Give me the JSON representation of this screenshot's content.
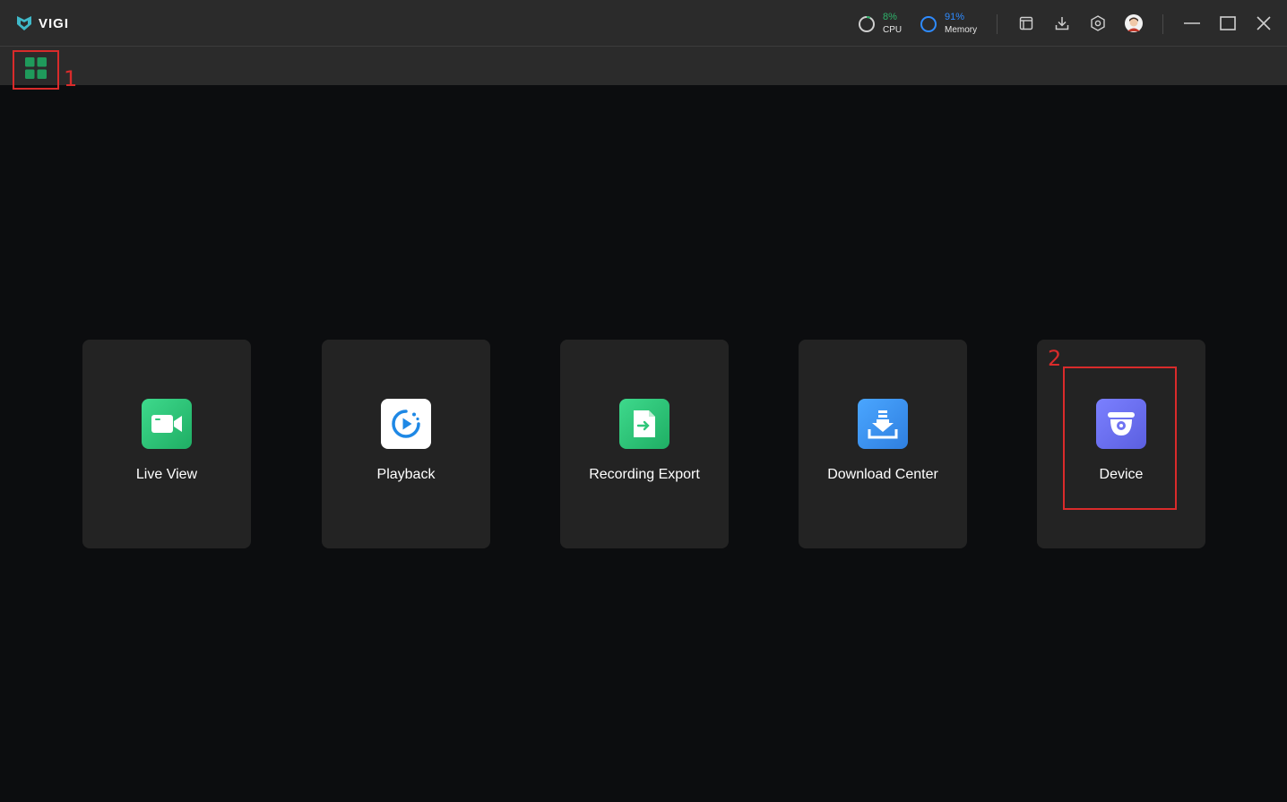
{
  "app": {
    "name": "VIGI"
  },
  "monitors": {
    "cpu": {
      "value": "8%",
      "label": "CPU",
      "color": "#2fb36b"
    },
    "memory": {
      "value": "91%",
      "label": "Memory",
      "color": "#2e8bff"
    }
  },
  "toolbar": {
    "icons": [
      "window-icon",
      "download-icon",
      "settings-icon",
      "avatar"
    ],
    "window_controls": [
      "minimize-icon",
      "maximize-icon",
      "close-icon"
    ]
  },
  "tabs": {
    "home_icon": "grid-icon"
  },
  "annotations": {
    "step1": "1",
    "step2": "2",
    "color": "#d92b2b"
  },
  "apps": [
    {
      "label": "Live View",
      "icon": "video-camera-icon",
      "color": "#2fc77a"
    },
    {
      "label": "Playback",
      "icon": "playback-icon",
      "color": "#ffffff"
    },
    {
      "label": "Recording Export",
      "icon": "file-export-icon",
      "color": "#2fc77a"
    },
    {
      "label": "Download Center",
      "icon": "download-center-icon",
      "color": "#3d95f0"
    },
    {
      "label": "Device",
      "icon": "dome-camera-icon",
      "color": "#6f73f2"
    }
  ]
}
